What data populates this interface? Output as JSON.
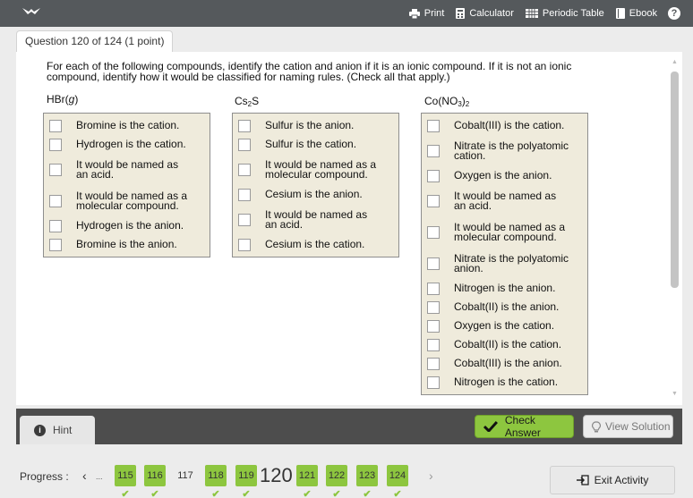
{
  "toolbar": {
    "print": "Print",
    "calculator": "Calculator",
    "periodic_table": "Periodic Table",
    "ebook": "Ebook",
    "help": "?"
  },
  "question_tab": "Question 120 of 124 (1 point)",
  "prompt": "For each of the following compounds, identify the cation and anion if it is an ionic compound. If it is not an ionic compound, identify how it would be classified for naming rules. (Check all that apply.)",
  "columns": [
    {
      "title_main": "HBr(",
      "title_italic": "g",
      "title_end": ")",
      "options": [
        "Bromine is the cation.",
        "Hydrogen is the cation.",
        "It would be named as an acid.",
        "It would be named as a molecular compound.",
        "Hydrogen is the anion.",
        "Bromine is the anion."
      ]
    },
    {
      "title_main": "Cs",
      "title_sub": "2",
      "title_end": "S",
      "options": [
        "Sulfur is the anion.",
        "Sulfur is the cation.",
        "It would be named as a molecular compound.",
        "Cesium is the anion.",
        "It would be named as an acid.",
        "Cesium is the cation."
      ]
    },
    {
      "title_main": "Co(NO",
      "title_sub": "3",
      "title_end": ")",
      "title_sub2": "2",
      "options": [
        "Cobalt(III) is the cation.",
        "Nitrate is the polyatomic cation.",
        "Oxygen is the anion.",
        "It would be named as an acid.",
        "It would be named as a molecular compound.",
        "Nitrate is the polyatomic anion.",
        "Nitrogen is the anion.",
        "Cobalt(II) is the anion.",
        "Oxygen is the cation.",
        "Cobalt(II) is the cation.",
        "Cobalt(III) is the anion.",
        "Nitrogen is the cation."
      ]
    }
  ],
  "actions": {
    "hint": "Hint",
    "check_answer": "Check Answer",
    "view_solution": "View Solution"
  },
  "progress": {
    "label": "Progress :",
    "ellipsis": "...",
    "prev": "‹",
    "next": "›",
    "items": [
      {
        "n": "115",
        "done": true
      },
      {
        "n": "116",
        "done": true
      },
      {
        "n": "117",
        "done": false
      },
      {
        "n": "118",
        "done": true
      },
      {
        "n": "119",
        "done": true
      },
      {
        "n": "120",
        "done": false,
        "current": true
      },
      {
        "n": "121",
        "done": true
      },
      {
        "n": "122",
        "done": true
      },
      {
        "n": "123",
        "done": true
      },
      {
        "n": "124",
        "done": true
      }
    ],
    "exit": "Exit Activity"
  },
  "colors": {
    "topbar": "#55595c",
    "answer_box": "#efebdc",
    "accent_green": "#8dc63f",
    "action_bar": "#4d4d4d"
  }
}
